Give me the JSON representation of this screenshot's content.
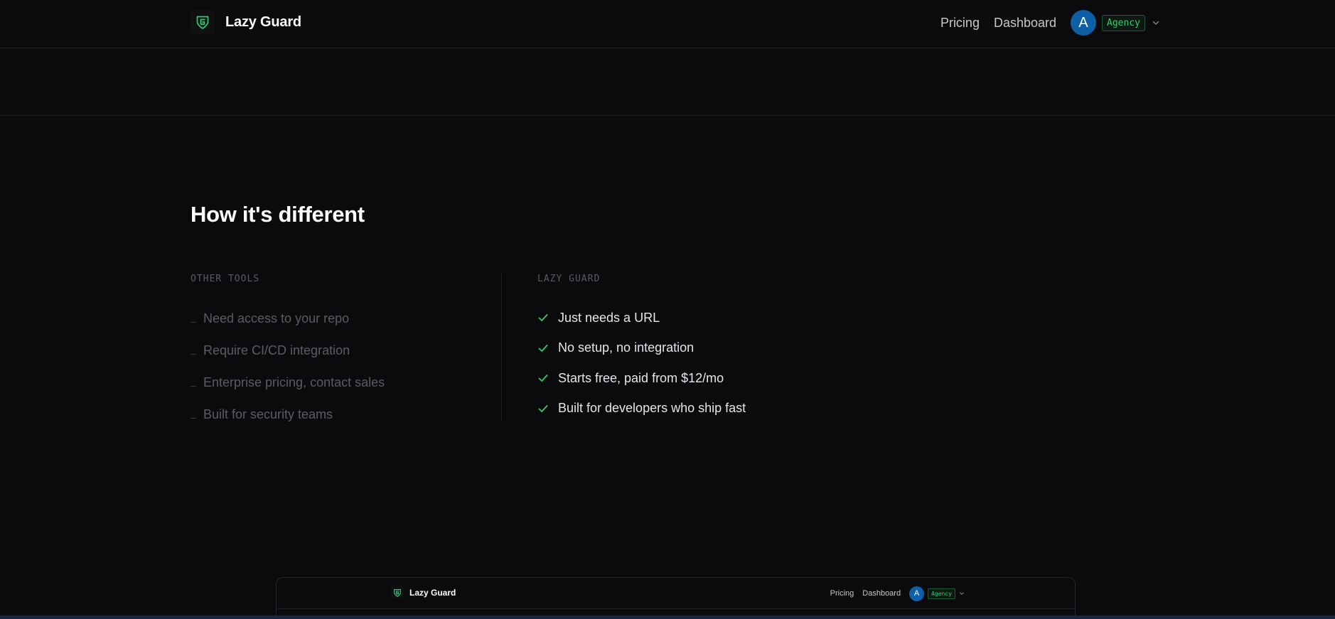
{
  "header": {
    "brand_name": "Lazy Guard",
    "logo_icon": "shield-g-icon",
    "nav": {
      "pricing": "Pricing",
      "dashboard": "Dashboard"
    },
    "user": {
      "avatar_initial": "A",
      "plan_badge": "Agency",
      "menu_icon": "chevron-down-icon"
    }
  },
  "section": {
    "title": "How it's different",
    "other_tools": {
      "label": "OTHER TOOLS",
      "items": [
        "Need access to your repo",
        "Require CI/CD integration",
        "Enterprise pricing, contact sales",
        "Built for security teams"
      ]
    },
    "lazy_guard": {
      "label": "LAZY GUARD",
      "items": [
        "Just needs a URL",
        "No setup, no integration",
        "Starts free, paid from $12/mo",
        "Built for developers who ship fast"
      ]
    }
  },
  "preview": {
    "brand_name": "Lazy Guard",
    "nav": {
      "pricing": "Pricing",
      "dashboard": "Dashboard"
    },
    "user": {
      "avatar_initial": "A",
      "plan_badge": "Agency"
    }
  },
  "colors": {
    "background": "#0b0b0e",
    "accent_green": "#2ecc71",
    "avatar_blue": "#0d5fa6",
    "muted_text": "#5b5b63"
  }
}
